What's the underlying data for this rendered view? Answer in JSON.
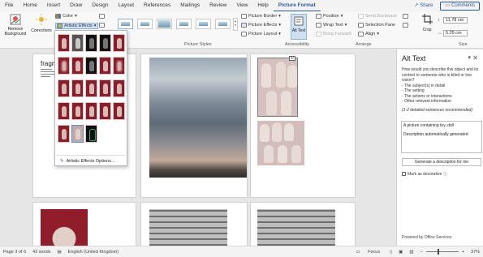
{
  "menu": {
    "items": [
      "File",
      "Home",
      "Insert",
      "Draw",
      "Design",
      "Layout",
      "References",
      "Mailings",
      "Review",
      "View",
      "Help",
      "Picture Format"
    ],
    "share": "Share",
    "comments": "Comments"
  },
  "ribbon": {
    "remove_background": "Remove Background",
    "corrections": "Corrections",
    "color": "Color",
    "artistic_effects": "Artistic Effects",
    "picture_styles_label": "Picture Styles",
    "picture_border": "Picture Border",
    "picture_effects": "Picture Effects",
    "picture_layout": "Picture Layout",
    "alt_text": "Alt Text",
    "accessibility_label": "Accessibility",
    "position": "Position",
    "wrap_text": "Wrap Text",
    "bring_forward": "Bring Forward",
    "send_backward": "Send Backward",
    "selection_pane": "Selection Pane",
    "align": "Align",
    "arrange_label": "Arrange",
    "crop": "Crop",
    "height": "11.78 cm",
    "width": "5.29 cm",
    "size_label": "Size"
  },
  "dropdown": {
    "options_label": "Artistic Effects Options..."
  },
  "document": {
    "page1_heading": "fragm"
  },
  "alt_text_pane": {
    "title": "Alt Text",
    "intro": "How would you describe this object and its context to someone who is blind or low vision?",
    "bullets": [
      "- The subject(s) in detail",
      "- The setting",
      "- The actions or interactions",
      "- Other relevant information"
    ],
    "hint": "(1-2 detailed sentences recommended)",
    "text_line1": "A picture containing toy, doll",
    "text_line2": "Description automatically generated",
    "generate_button": "Generate a description for me",
    "decorative": "Mark as decorative",
    "footer": "Powered by Office Services"
  },
  "status": {
    "page": "Page 3 of 6",
    "words": "42 words",
    "language": "English (United Kingdom)",
    "focus": "Focus",
    "zoom": "37%"
  }
}
